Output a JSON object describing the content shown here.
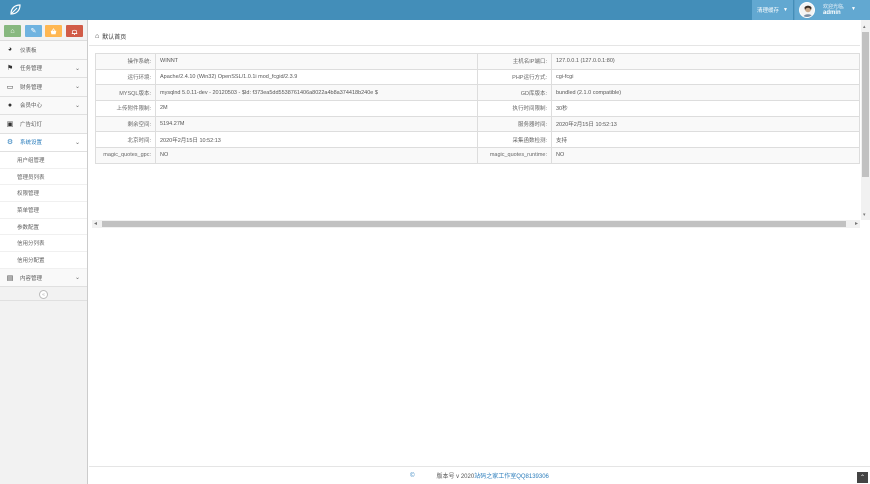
{
  "navbar": {
    "clear_cache": "清理缓存",
    "welcome": "欢迎光临,",
    "username": "admin",
    "accent": "#438eb9"
  },
  "shortcuts": [
    {
      "icon": "home-icon",
      "color": "#87b87f"
    },
    {
      "icon": "pencil-icon",
      "color": "#6fb3e0"
    },
    {
      "icon": "basket-icon",
      "color": "#ffb752"
    },
    {
      "icon": "bell-icon",
      "color": "#d15b47"
    }
  ],
  "sidebar": {
    "items": [
      {
        "label": "仪表板",
        "icon": "dashboard-icon"
      },
      {
        "label": "任务管理",
        "icon": "flag-icon"
      },
      {
        "label": "财务管理",
        "icon": "hdd-icon"
      },
      {
        "label": "会员中心",
        "icon": "user-icon"
      },
      {
        "label": "广告幻灯",
        "icon": "picture-icon"
      },
      {
        "label": "系统设置",
        "icon": "gear-icon"
      },
      {
        "label": "内容管理",
        "icon": "book-icon"
      }
    ],
    "sub_items": [
      "用户组管理",
      "管理员列表",
      "权限管理",
      "菜单管理",
      "参数配置",
      "信用分列表",
      "信用分配置"
    ]
  },
  "breadcrumb": {
    "label": "默认首页"
  },
  "info_table": [
    {
      "k1": "操作系统:",
      "v1": "WINNT",
      "k2": "主机名IP端口:",
      "v2": "127.0.0.1 (127.0.0.1:80)"
    },
    {
      "k1": "运行环境:",
      "v1": "Apache/2.4.10 (Win32) OpenSSL/1.0.1i mod_fcgid/2.3.9",
      "k2": "PHP运行方式:",
      "v2": "cgi-fcgi"
    },
    {
      "k1": "MYSQL版本:",
      "v1": "mysqlnd 5.0.11-dev - 20120503 - $Id: f373ea5dd5538761406a8022a4b8a374418b240e $",
      "k2": "GD库版本:",
      "v2": "bundled (2.1.0 compatible)"
    },
    {
      "k1": "上传附件限制:",
      "v1": "2M",
      "k2": "执行时间限制:",
      "v2": "30秒"
    },
    {
      "k1": "剩余空间:",
      "v1": "5194.27M",
      "k2": "服务器时间:",
      "v2": "2020年2月15日 10:52:13"
    },
    {
      "k1": "北京时间:",
      "v1": "2020年2月15日 10:52:13",
      "k2": "采集函数检测:",
      "v2": "支持"
    },
    {
      "k1": "magic_quotes_gpc:",
      "v1": "NO",
      "k2": "magic_quotes_runtime:",
      "v2": "NO"
    }
  ],
  "footer": {
    "copyright": "©",
    "version": "版本号 v 2020 ",
    "link": "站码之家工作室QQ8139306"
  }
}
